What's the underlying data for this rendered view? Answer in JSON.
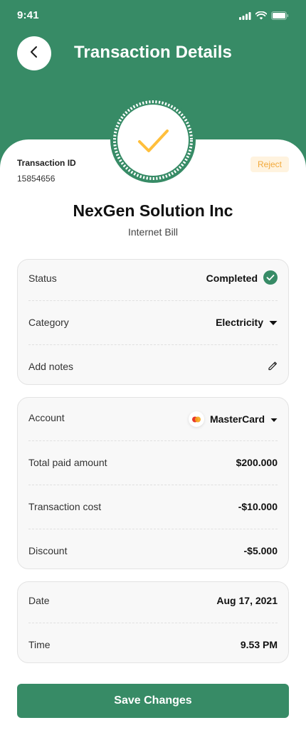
{
  "status_bar": {
    "time": "9:41"
  },
  "header": {
    "title": "Transaction Details"
  },
  "transaction": {
    "id_label": "Transaction ID",
    "id_value": "15854656",
    "reject_label": "Reject",
    "merchant": "NexGen Solution Inc",
    "bill_type": "Internet Bill"
  },
  "details_card": {
    "status_label": "Status",
    "status_value": "Completed",
    "category_label": "Category",
    "category_value": "Electricity",
    "notes_label": "Add notes"
  },
  "payment_card": {
    "account_label": "Account",
    "account_value": "MasterCard",
    "total_label": "Total paid amount",
    "total_value": "$200.000",
    "cost_label": "Transaction cost",
    "cost_value": "-$10.000",
    "discount_label": "Discount",
    "discount_value": "-$5.000"
  },
  "datetime_card": {
    "date_label": "Date",
    "date_value": "Aug 17, 2021",
    "time_label": "Time",
    "time_value": "9.53 PM"
  },
  "actions": {
    "save_label": "Save Changes"
  },
  "colors": {
    "primary": "#378b66",
    "success_check": "#ffbf3c",
    "reject_bg": "#fff3df",
    "reject_text": "#f2a93b"
  },
  "icons": {
    "back": "chevron-left-icon",
    "badge": "checkmark-icon",
    "status": "check-circle-icon",
    "category": "caret-down-icon",
    "notes": "pencil-icon",
    "account": "mastercard-icon"
  }
}
